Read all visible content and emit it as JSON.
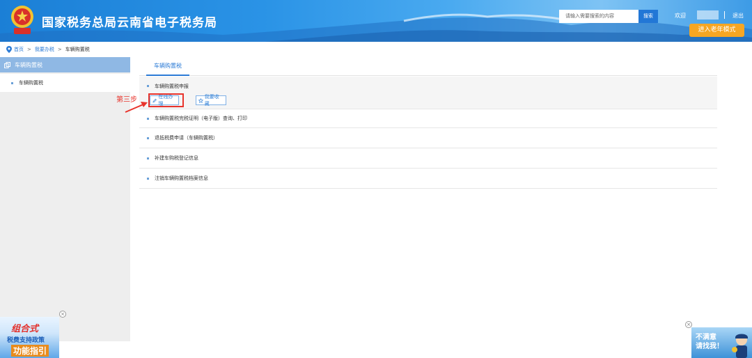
{
  "header": {
    "site_title": "国家税务总局云南省电子税务局",
    "search_placeholder": "请输入需要搜索的内容",
    "search_button": "搜索",
    "welcome": "欢迎",
    "logout": "退出",
    "elder_mode": "进入老年模式"
  },
  "breadcrumb": {
    "home": "首页",
    "sep1": ">",
    "level2": "我要办税",
    "sep2": ">",
    "current": "车辆购置税"
  },
  "sidebar": {
    "header": "车辆购置税",
    "items": [
      {
        "label": "车辆购置税"
      }
    ]
  },
  "main": {
    "tab": "车辆购置税",
    "rows": [
      {
        "label": "车辆购置税申报"
      },
      {
        "label": "车辆购置税完税证明（电子版）查询、打印"
      },
      {
        "label": "退抵税费申请（车辆购置税）"
      },
      {
        "label": "补建车购税登记信息"
      },
      {
        "label": "注销车辆购置税档案信息"
      }
    ],
    "actions": {
      "online": "在线办理",
      "favorite": "我要收藏"
    },
    "annotation": "第三步"
  },
  "ads": {
    "left_line1": "组合式",
    "left_line2": "税费支持政策",
    "left_line3": "功能指引",
    "right_line1": "不满意",
    "right_line2": "请找我！",
    "close": "×"
  },
  "colors": {
    "header_blue": "#2a93e6",
    "accent": "#2b7bd6",
    "elder_orange": "#f6a623",
    "annotation_red": "#e8332b"
  }
}
